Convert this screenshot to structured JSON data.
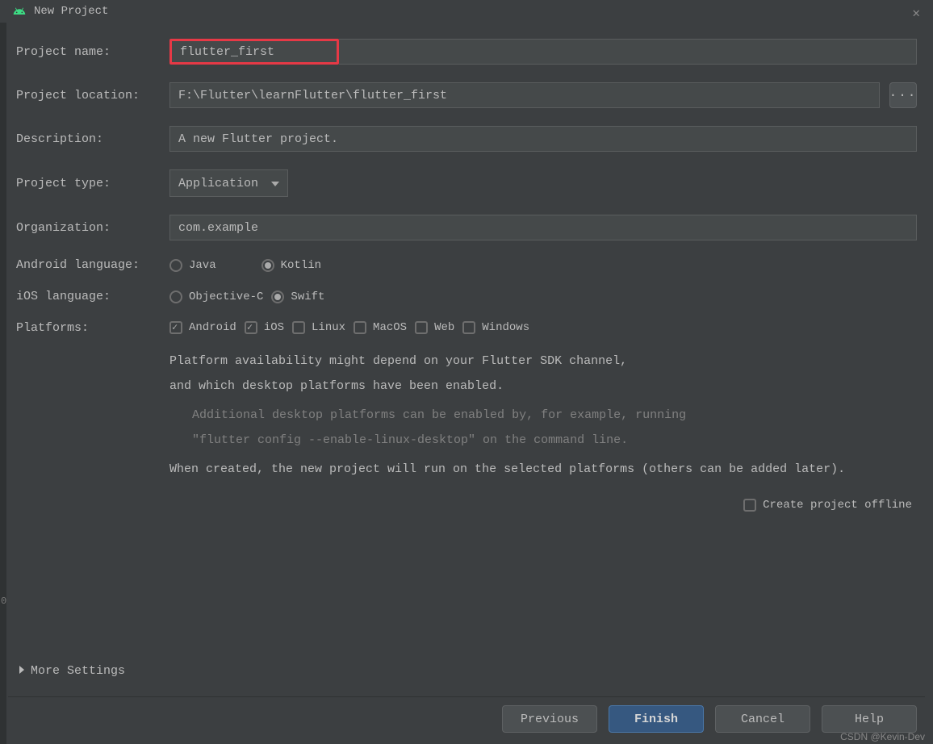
{
  "window": {
    "title": "New Project"
  },
  "form": {
    "projectName": {
      "label": "Project name:",
      "value": "flutter_first"
    },
    "projectLocation": {
      "label": "Project location:",
      "value": "F:\\Flutter\\learnFlutter\\flutter_first"
    },
    "description": {
      "label": "Description:",
      "value": "A new Flutter project."
    },
    "projectType": {
      "label": "Project type:",
      "value": "Application"
    },
    "organization": {
      "label": "Organization:",
      "value": "com.example"
    },
    "androidLanguage": {
      "label": "Android language:",
      "options": [
        {
          "label": "Java",
          "selected": false
        },
        {
          "label": "Kotlin",
          "selected": true
        }
      ]
    },
    "iosLanguage": {
      "label": "iOS language:",
      "options": [
        {
          "label": "Objective-C",
          "selected": false
        },
        {
          "label": "Swift",
          "selected": true
        }
      ]
    },
    "platforms": {
      "label": "Platforms:",
      "options": [
        {
          "label": "Android",
          "checked": true
        },
        {
          "label": "iOS",
          "checked": true
        },
        {
          "label": "Linux",
          "checked": false
        },
        {
          "label": "MacOS",
          "checked": false
        },
        {
          "label": "Web",
          "checked": false
        },
        {
          "label": "Windows",
          "checked": false
        }
      ]
    },
    "info": {
      "line1": "Platform availability might depend on your Flutter SDK channel,",
      "line2": "and which desktop platforms have been enabled.",
      "line3": "Additional desktop platforms can be enabled by, for example, running",
      "line4": "\"flutter config --enable-linux-desktop\" on the command line.",
      "line5": "When created, the new project will run on the selected platforms (others can be added later)."
    },
    "offline": {
      "label": "Create project offline",
      "checked": false
    }
  },
  "moreSettings": "More Settings",
  "buttons": {
    "previous": "Previous",
    "finish": "Finish",
    "cancel": "Cancel",
    "help": "Help"
  },
  "sideNum": "0",
  "watermark": "CSDN @Kevin-Dev"
}
